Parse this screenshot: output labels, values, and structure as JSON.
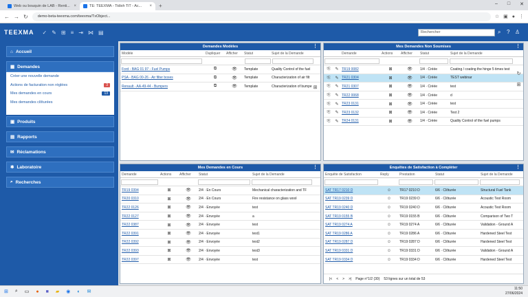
{
  "browser": {
    "tabs": [
      {
        "label": "Web ou bouquin de LAB - Renti..."
      },
      {
        "label": "TE: TEEXMA - Tidixh TiT - Ac..."
      }
    ],
    "url": "demo-beta-teexma.com/teexma/TxObject..."
  },
  "app": {
    "logo": "TEEXMA",
    "search_placeholder": "Rechercher"
  },
  "menu": {
    "accueil": "Accueil",
    "demandes": "Demandes",
    "produits": "Produits",
    "rapports": "Rapports",
    "reclamations": "Réclamations",
    "laboratoire": "Laboratoire",
    "recherches": "Recherches",
    "sub": [
      {
        "label": "Créer une nouvelle demande",
        "badge": ""
      },
      {
        "label": "Actions de facturation non réglées",
        "badge": "3",
        "badge_color": "#d9534f"
      },
      {
        "label": "Mes demandes en cours",
        "badge": "13",
        "badge_color": "#1e5aa8"
      },
      {
        "label": "Mes demandes clôturées",
        "badge": ""
      }
    ]
  },
  "p1": {
    "title": "Demandes Modèles",
    "cols": [
      "Modèle",
      "Dupliquer",
      "Afficher",
      "Statut",
      "Sujet de la Demande"
    ],
    "rows": [
      {
        "modele": "Ford - BAG 01 97 - Fuel Pumps",
        "statut": "Template",
        "sujet": "Quality Control of the fuel"
      },
      {
        "modele": "PSA - BAG 00-26 - Air filter boxes",
        "statut": "Template",
        "sujet": "Characterization of air filt"
      },
      {
        "modele": "Renault - AA-49-44 - Bumpers",
        "statut": "Template",
        "sujet": "Characterization of bumpe"
      }
    ]
  },
  "p2": {
    "title": "Mes Demandes Non Soumises",
    "cols": [
      "Demande",
      "Actions",
      "Afficher",
      "Statut",
      "Sujet de la Demande"
    ],
    "rows": [
      {
        "id": "TR19 0082",
        "statut": "1/4 · Créée",
        "sujet": "Coating / coating the hinge 5 times test"
      },
      {
        "id": "TR21 0304",
        "statut": "1/4 · Créée",
        "sujet": "TEST webinar"
      },
      {
        "id": "TR21 0307",
        "statut": "1/4 · Créée",
        "sujet": "test"
      },
      {
        "id": "TR22 0068",
        "statut": "1/4 · Créée",
        "sujet": "d"
      },
      {
        "id": "TR23 0131",
        "statut": "1/4 · Créée",
        "sujet": "test"
      },
      {
        "id": "TR23 0132",
        "statut": "1/4 · Créée",
        "sujet": "Test 2"
      },
      {
        "id": "TR24 0131",
        "statut": "1/4 · Créée",
        "sujet": "Quality Control of the fuel pumps"
      }
    ]
  },
  "p3": {
    "title": "Mes Demandes en Cours",
    "cols": [
      "Demande",
      "Actions",
      "Afficher",
      "Statut",
      "Sujet de la Demande"
    ],
    "rows": [
      {
        "id": "TR19 0394",
        "statut": "2/4 · En Cours",
        "sujet": "Mechanical characterization and TF"
      },
      {
        "id": "TR20 0310",
        "statut": "2/4 · En Cours",
        "sujet": "Fire resistance on glass wool"
      },
      {
        "id": "TR22 0126",
        "statut": "2/4 · Envoyée",
        "sujet": "test"
      },
      {
        "id": "TR22 0127",
        "statut": "2/4 · Envoyée",
        "sujet": "a"
      },
      {
        "id": "TR22 0387",
        "statut": "2/4 · Envoyée",
        "sujet": "test"
      },
      {
        "id": "TR22 0391",
        "statut": "2/4 · Envoyée",
        "sujet": "test1"
      },
      {
        "id": "TR22 0392",
        "statut": "2/4 · Envoyée",
        "sujet": "test2"
      },
      {
        "id": "TR22 0393",
        "statut": "2/4 · Envoyée",
        "sujet": "test3"
      },
      {
        "id": "TR22 0397",
        "statut": "2/4 · Envoyée",
        "sujet": "test"
      }
    ]
  },
  "p4": {
    "title": "Enquêtes de Satisfaction à Compléter",
    "cols": [
      "Enquête de Satisfaction",
      "Reply",
      "Prestation",
      "Statut",
      "Sujet de la Demande"
    ],
    "rows": [
      {
        "id": "SAT TR17 0210 D",
        "prest": "TR17 0210 D",
        "statut": "6/6 · Clôturée",
        "sujet": "Structural Fuel Tank"
      },
      {
        "id": "SAT TR19 0239 D",
        "prest": "TR19 0239 D",
        "statut": "6/6 · Clôturée",
        "sujet": "Acoustic Test Room"
      },
      {
        "id": "SAT TR19 0240 D",
        "prest": "TR19 0240 D",
        "statut": "6/6 · Clôturée",
        "sujet": "Acoustic Test Room"
      },
      {
        "id": "SAT TR19 0155 B",
        "prest": "TR19 0155 B",
        "statut": "6/6 · Clôturée",
        "sujet": "Comparison of Two T"
      },
      {
        "id": "SAT TR19 0274 A",
        "prest": "TR19 0274 A",
        "statut": "6/6 · Clôturée",
        "sujet": "Validation - Ground A"
      },
      {
        "id": "SAT TR19 0286 A",
        "prest": "TR19 0286 A",
        "statut": "6/6 · Clôturée",
        "sujet": "Hardened Steel Test"
      },
      {
        "id": "SAT TR19 0287 D",
        "prest": "TR19 0287 D",
        "statut": "6/6 · Clôturée",
        "sujet": "Hardened Steel Test"
      },
      {
        "id": "SAT TR19 0331 D",
        "prest": "TR19 0331 D",
        "statut": "6/6 · Clôturée",
        "sujet": "Validation - Ground A"
      },
      {
        "id": "SAT TR19 0334 D",
        "prest": "TR19 0334 D",
        "statut": "6/6 · Clôturée",
        "sujet": "Hardened Steel Test"
      }
    ],
    "page": "Page n°1/2 (30)",
    "total": "53 lignes sur un total de 53"
  },
  "taskbar": {
    "time": "11:50",
    "date": "27/06/2024"
  }
}
